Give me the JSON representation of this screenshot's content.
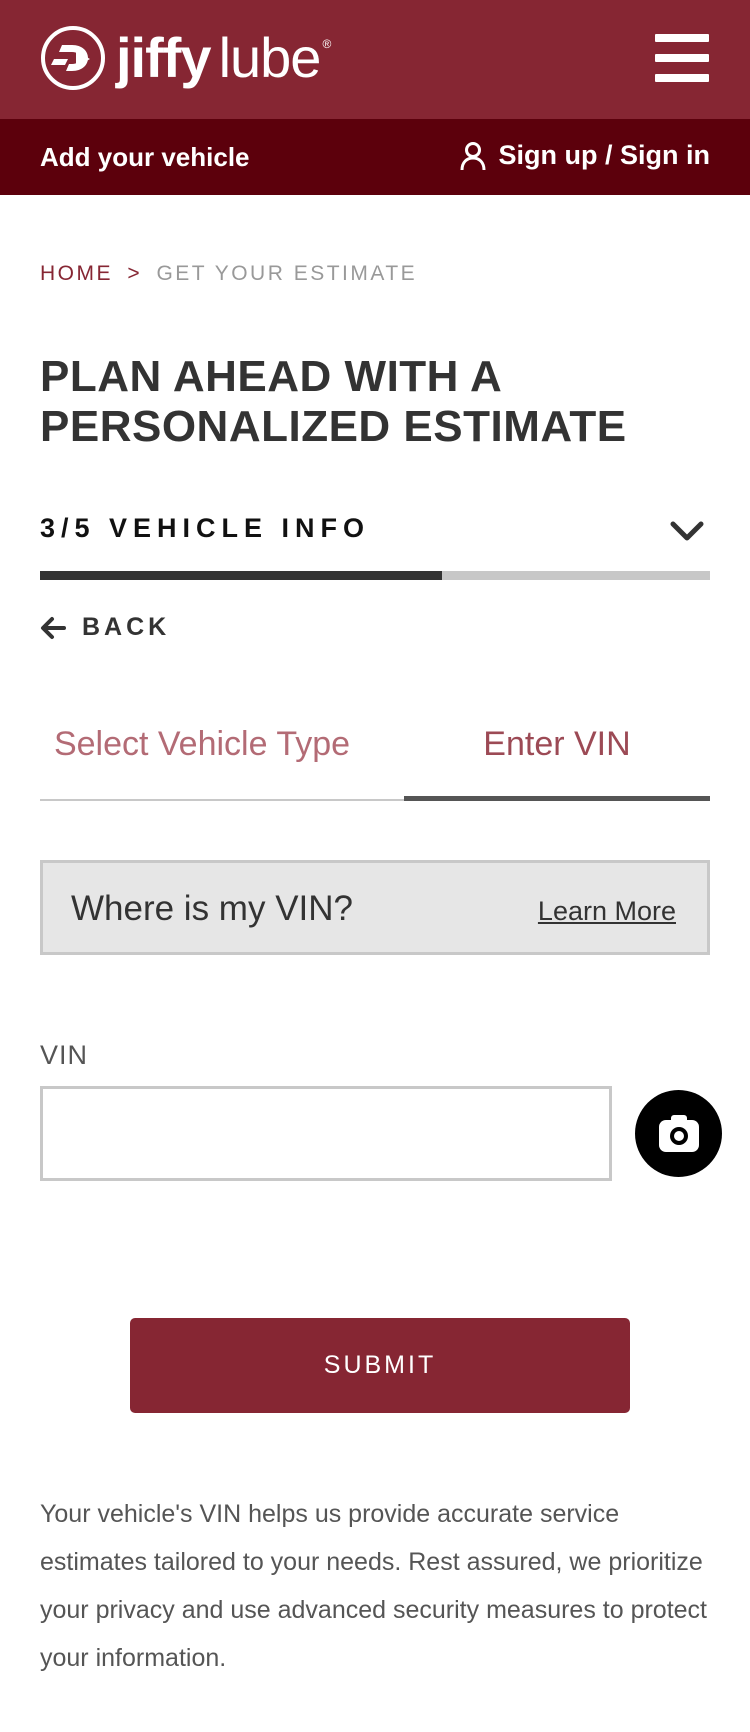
{
  "header": {
    "brand_primary": "jiffy",
    "brand_secondary": "lube",
    "brand_mark": "®",
    "menu_icon": "hamburger-icon",
    "brand_color": "#862633"
  },
  "subbar": {
    "add_vehicle": "Add your vehicle",
    "signin": "Sign up / Sign in",
    "user_icon": "user-icon",
    "color": "#5c000c"
  },
  "breadcrumb": {
    "home": "HOME",
    "separator": ">",
    "current": "GET YOUR ESTIMATE"
  },
  "page_title": "PLAN AHEAD WITH A PERSONALIZED ESTIMATE",
  "step": {
    "label": "3/5 VEHICLE INFO",
    "progress": 0.6
  },
  "back_label": "BACK",
  "tabs": [
    {
      "label": "Select Vehicle Type",
      "active": false
    },
    {
      "label": "Enter VIN",
      "active": true
    }
  ],
  "vin_help": {
    "text": "Where is my VIN?",
    "link": "Learn More"
  },
  "vin_field": {
    "label": "VIN",
    "value": "",
    "placeholder": "",
    "camera_icon": "camera-icon"
  },
  "submit_label": "SUBMIT",
  "disclaimer": "Your vehicle's VIN helps us provide accurate service estimates tailored to your needs. Rest assured, we prioritize your privacy and use advanced security measures to protect your information."
}
